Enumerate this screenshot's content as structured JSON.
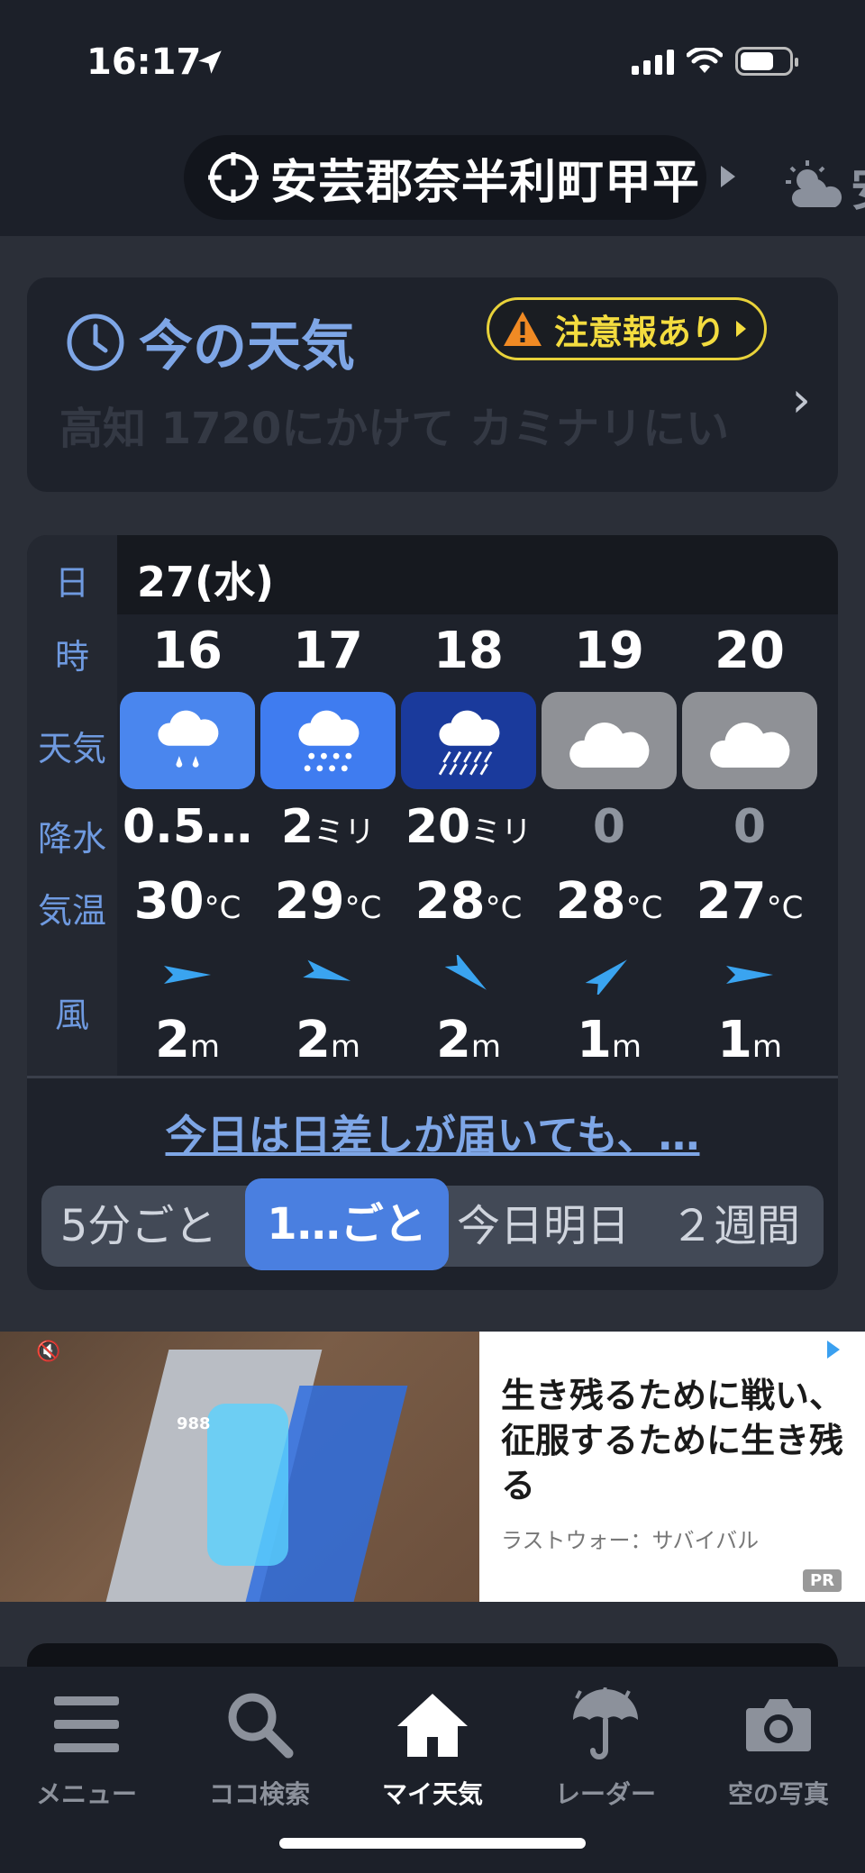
{
  "status": {
    "time": "16:17"
  },
  "header": {
    "location": "安芸郡奈半利町甲平",
    "next_location": "安"
  },
  "now_card": {
    "title": "今の天気",
    "alert": "注意報あり",
    "faded_text": "高知 1720にかけて カミナリにい"
  },
  "forecast": {
    "labels": {
      "day": "日",
      "hour": "時",
      "weather": "天気",
      "precip": "降水",
      "temp": "気温",
      "wind": "風"
    },
    "date": "27(水)",
    "columns": [
      {
        "hour": "16",
        "weather": "light-rain-icon",
        "bg": "#4a86ee",
        "precip": "0.5…",
        "precip_unit": "",
        "temp": "30",
        "temp_unit": "°C",
        "wind_dir": 90,
        "wind_speed": "2",
        "wind_unit": "m"
      },
      {
        "hour": "17",
        "weather": "rain-icon",
        "bg": "#3f7cf0",
        "precip": "2",
        "precip_unit": "ミリ",
        "temp": "29",
        "temp_unit": "°C",
        "wind_dir": 105,
        "wind_speed": "2",
        "wind_unit": "m"
      },
      {
        "hour": "18",
        "weather": "heavy-rain-icon",
        "bg": "#1a3a9c",
        "precip": "20",
        "precip_unit": "ミリ",
        "temp": "28",
        "temp_unit": "°C",
        "wind_dir": 130,
        "wind_speed": "2",
        "wind_unit": "m"
      },
      {
        "hour": "19",
        "weather": "cloudy-icon",
        "bg": "#8f9196",
        "precip": "0",
        "precip_unit": "",
        "temp": "28",
        "temp_unit": "°C",
        "wind_dir": 50,
        "wind_speed": "1",
        "wind_unit": "m"
      },
      {
        "hour": "20",
        "weather": "cloudy-icon",
        "bg": "#8f9196",
        "precip": "0",
        "precip_unit": "",
        "temp": "27",
        "temp_unit": "°C",
        "wind_dir": 90,
        "wind_speed": "1",
        "wind_unit": "m"
      }
    ],
    "link_text": "今日は日差しが届いても、…",
    "segments": [
      "5分ごと",
      "1…ごと",
      "今日明日",
      "２週間"
    ],
    "active_segment": 1
  },
  "ad": {
    "headline": "生き残るために戦い、征服するために生き残る",
    "advertiser": "ラストウォー：サバイバル",
    "badge": "PR",
    "game_number": "988"
  },
  "tabbar": {
    "items": [
      {
        "label": "メニュー",
        "icon": "menu-icon"
      },
      {
        "label": "ココ検索",
        "icon": "search-icon"
      },
      {
        "label": "マイ天気",
        "icon": "home-icon"
      },
      {
        "label": "レーダー",
        "icon": "umbrella-radar-icon"
      },
      {
        "label": "空の写真",
        "icon": "camera-icon"
      }
    ],
    "active": 2
  },
  "colors": {
    "accent": "#7ea6e6",
    "alert": "#f3dc3f",
    "active_tab": "#4a7fe0"
  }
}
